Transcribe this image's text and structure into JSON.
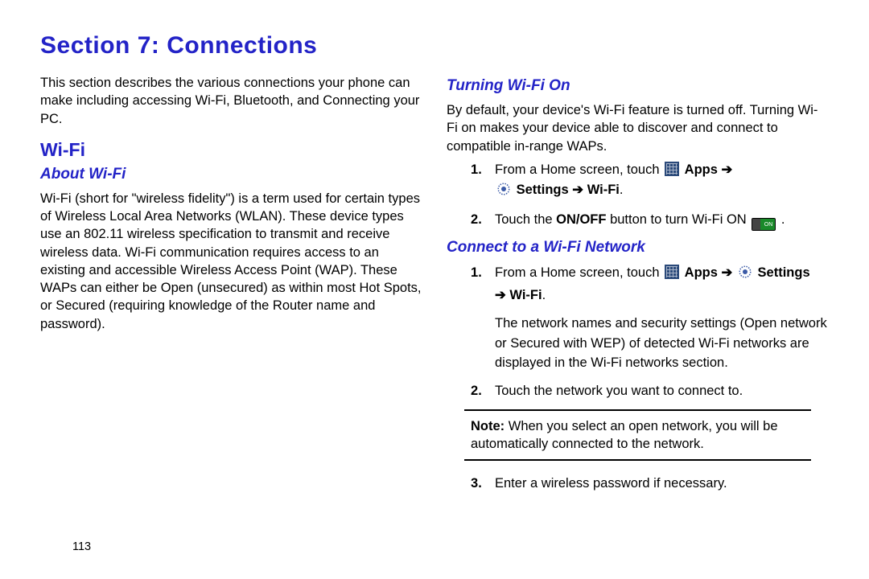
{
  "title": "Section 7: Connections",
  "intro": "This section describes the various connections your phone can make including accessing Wi-Fi, Bluetooth, and Connecting your PC.",
  "topic_wifi": "Wi-Fi",
  "sub_about": "About Wi-Fi",
  "about_text": "Wi-Fi (short for \"wireless fidelity\") is a term used for certain types of Wireless Local Area Networks (WLAN). These device types use an 802.11 wireless specification to transmit and receive wireless data. Wi-Fi communication requires access to an existing and accessible Wireless Access Point (WAP). These WAPs can either be Open (unsecured) as within most Hot Spots, or Secured (requiring knowledge of the Router name and password).",
  "sub_turning_on": "Turning Wi-Fi On",
  "turning_on_text": "By default, your device's Wi-Fi feature is turned off. Turning Wi-Fi on makes your device able to discover and connect to compatible in-range WAPs.",
  "steps_turn_on": {
    "s1_a": "From a Home screen, touch ",
    "s1_apps": " Apps ",
    "s1_settings": " Settings ",
    "s1_wifi": " Wi-Fi",
    "period": ".",
    "s2_a": "Touch the ",
    "s2_onoff": "ON/OFF",
    "s2_b": " button to turn Wi-Fi ON "
  },
  "sub_connect": "Connect to a Wi-Fi Network",
  "steps_connect": {
    "s1_a": "From a Home screen, touch ",
    "s1_apps": " Apps ",
    "s1_settings": " Settings",
    "s1_wifi": " Wi-Fi",
    "period": ".",
    "s1_follow": "The network names and security settings (Open network or Secured with WEP) of detected Wi-Fi networks are displayed in the Wi-Fi networks section.",
    "s2": "Touch the network you want to connect to.",
    "s3": "Enter a wireless password if necessary."
  },
  "note_label": "Note:",
  "note_text": " When you select an open network, you will be automatically connected to the network.",
  "arrow": "➔",
  "on_label": "ON",
  "page_number": "113"
}
